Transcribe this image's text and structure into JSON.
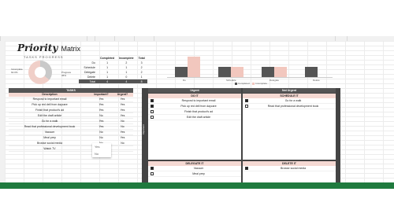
{
  "header": {
    "title": "Priority",
    "title_suffix": "Matrix",
    "subtitle": "TASKS PROGRESS",
    "donut_label_left": "Incomplete",
    "donut_label_left_pct": "64.0%",
    "donut_label_right": "Progress",
    "donut_label_right_pct": "36%"
  },
  "stats": {
    "columns": [
      "",
      "Completed",
      "Incomplete",
      "Total"
    ],
    "rows": [
      {
        "label": "Do",
        "completed": "1",
        "incomplete": "2",
        "total": "3"
      },
      {
        "label": "Schedule",
        "completed": "1",
        "incomplete": "1",
        "total": "2"
      },
      {
        "label": "Delegate",
        "completed": "1",
        "incomplete": "1",
        "total": "2"
      },
      {
        "label": "Delete",
        "completed": "1",
        "incomplete": "0",
        "total": "1"
      },
      {
        "label": "Total",
        "completed": "4",
        "incomplete": "4",
        "total": "8"
      }
    ]
  },
  "chart_data": {
    "type": "bar",
    "categories": [
      "Do",
      "Schedule",
      "Delegate",
      "Delete"
    ],
    "series": [
      {
        "name": "Completed",
        "values": [
          1,
          1,
          1,
          1
        ]
      },
      {
        "name": "Incomplete",
        "values": [
          2,
          1,
          1,
          0
        ]
      }
    ],
    "ylim": [
      0,
      2
    ],
    "colors": [
      "#555555",
      "#f2c7be"
    ],
    "legend": "bottom"
  },
  "tasks": {
    "title": "TASKS",
    "columns": [
      "Description",
      "Important?",
      "Urgent?"
    ],
    "rows": [
      {
        "desc": "Respond to important email",
        "imp": "Yes",
        "urg": "Yes"
      },
      {
        "desc": "Pick up red dell from daycare",
        "imp": "Yes",
        "urg": "Yes"
      },
      {
        "desc": "Finish that product's ad",
        "imp": "Yes",
        "urg": "Yes"
      },
      {
        "desc": "Edit the draft article",
        "imp": "No",
        "urg": "Yes"
      },
      {
        "desc": "Go for a walk",
        "imp": "Yes",
        "urg": "No"
      },
      {
        "desc": "Read that professional development book",
        "imp": "Yes",
        "urg": "No"
      },
      {
        "desc": "Vacuum",
        "imp": "No",
        "urg": "Yes"
      },
      {
        "desc": "Meal prep",
        "imp": "No",
        "urg": "Yes"
      },
      {
        "desc": "Browse social media",
        "imp": "No",
        "urg": "No"
      },
      {
        "desc": "Watch TV",
        "imp": "",
        "urg": ""
      }
    ],
    "dropdown_options": [
      "Yes",
      "No"
    ]
  },
  "matrix": {
    "col_urgent": "Urgent",
    "col_not_urgent": "Not Urgent",
    "side_label": "Important",
    "do_it": {
      "title": "DO IT",
      "items": [
        {
          "text": "Respond to important email",
          "checked": true
        },
        {
          "text": "Pick up red dell from daycare",
          "checked": true
        },
        {
          "text": "Finish that product's ad",
          "checked": false
        },
        {
          "text": "Edit the draft article",
          "checked": false
        }
      ]
    },
    "schedule_it": {
      "title": "SCHEDULE IT",
      "items": [
        {
          "text": "Go for a walk",
          "checked": true
        },
        {
          "text": "Read that professional development book",
          "checked": false
        }
      ]
    },
    "delegate_it": {
      "title": "DELEGATE IT",
      "items": [
        {
          "text": "Vacuum",
          "checked": true
        },
        {
          "text": "Meal prep",
          "checked": false
        }
      ]
    },
    "delete_it": {
      "title": "DELETE IT",
      "items": [
        {
          "text": "Browse social media",
          "checked": true
        }
      ]
    }
  }
}
